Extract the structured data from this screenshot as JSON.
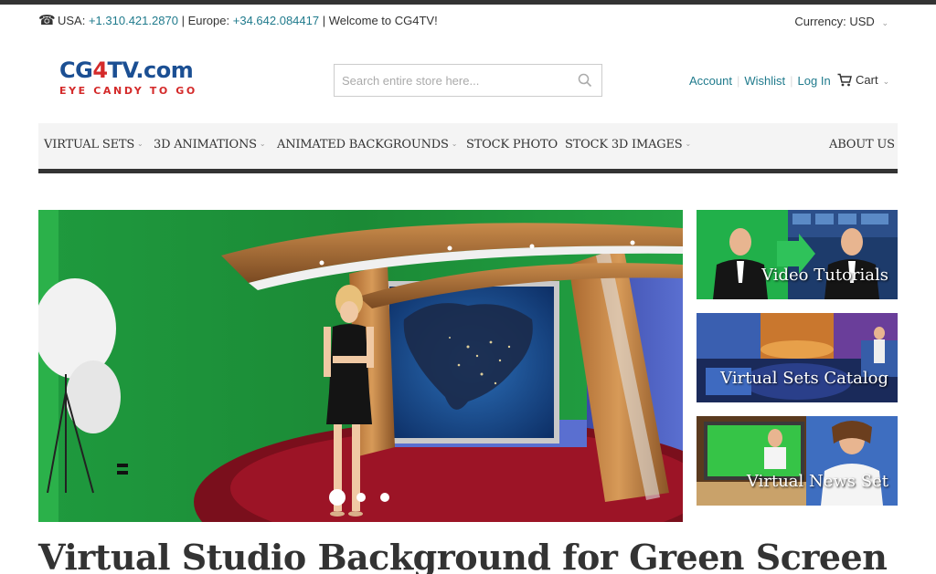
{
  "top_bar": {
    "usa_label": "USA:",
    "usa_phone": "+1.310.421.2870",
    "separator": "|",
    "europe_label": "Europe:",
    "europe_phone": "+34.642.084417",
    "welcome": "Welcome to CG4TV!",
    "currency_label": "Currency:",
    "currency_value": "USD"
  },
  "logo": {
    "brand_part1": "CG",
    "brand_part2": "4",
    "brand_part3": "TV.com",
    "tagline": "EYE CANDY TO GO"
  },
  "search": {
    "placeholder": "Search entire store here..."
  },
  "account": {
    "account_label": "Account",
    "wishlist_label": "Wishlist",
    "login_label": "Log In",
    "cart_label": "Cart"
  },
  "nav": {
    "items": [
      {
        "label": "VIRTUAL SETS",
        "has_dropdown": true
      },
      {
        "label": "3D ANIMATIONS",
        "has_dropdown": true
      },
      {
        "label": "ANIMATED BACKGROUNDS",
        "has_dropdown": true
      },
      {
        "label": "STOCK PHOTO",
        "has_dropdown": false
      },
      {
        "label": "STOCK 3D IMAGES",
        "has_dropdown": true
      },
      {
        "label": "ABOUT US",
        "has_dropdown": false
      }
    ]
  },
  "slider": {
    "slide_count": 3,
    "active_slide": 1
  },
  "promos": [
    {
      "caption": "Video Tutorials"
    },
    {
      "caption": "Virtual Sets Catalog"
    },
    {
      "caption": "Virtual News Set"
    }
  ],
  "page": {
    "title": "Virtual Studio Background for Green Screen"
  },
  "colors": {
    "link": "#1f7a8c",
    "logo_blue": "#1b4f93",
    "logo_red": "#d42a2a",
    "nav_bg": "#f4f4f4",
    "dark_bar": "#333333"
  }
}
